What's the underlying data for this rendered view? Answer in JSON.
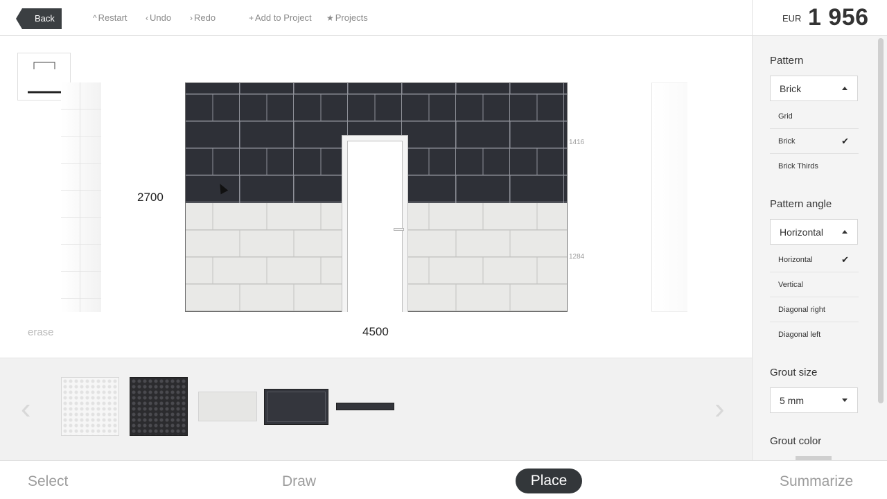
{
  "toolbar": {
    "back_label": "Back",
    "restart_label": "Restart",
    "undo_label": "Undo",
    "redo_label": "Redo",
    "add_to_project_label": "Add to Project",
    "projects_label": "Projects"
  },
  "price": {
    "currency": "EUR",
    "amount": "1 956"
  },
  "canvas": {
    "wall_height": "2700",
    "wall_width": "4500",
    "upper_height": "1416",
    "lower_height": "1284",
    "erase_label": "erase"
  },
  "nav": {
    "select": "Select",
    "draw": "Draw",
    "place": "Place",
    "summarize": "Summarize",
    "active": "Place"
  },
  "sidebar": {
    "pattern": {
      "title": "Pattern",
      "selected": "Brick",
      "options": [
        {
          "label": "Grid",
          "checked": false
        },
        {
          "label": "Brick",
          "checked": true
        },
        {
          "label": "Brick Thirds",
          "checked": false
        }
      ]
    },
    "pattern_angle": {
      "title": "Pattern angle",
      "selected": "Horizontal",
      "options": [
        {
          "label": "Horizontal",
          "checked": true
        },
        {
          "label": "Vertical",
          "checked": false
        },
        {
          "label": "Diagonal right",
          "checked": false
        },
        {
          "label": "Diagonal left",
          "checked": false
        }
      ]
    },
    "grout_size": {
      "title": "Grout size",
      "selected": "5 mm"
    },
    "grout_color": {
      "title": "Grout color"
    }
  },
  "colors": {
    "accent_dark": "#33373a",
    "dark_tile": "#2e3037",
    "light_tile": "#e9e9e7"
  },
  "icons": {
    "restart": "caret-up-icon",
    "undo": "chevron-left-icon",
    "redo": "chevron-right-icon",
    "add": "plus-icon",
    "projects": "star-icon",
    "checkmark": "check-icon"
  }
}
